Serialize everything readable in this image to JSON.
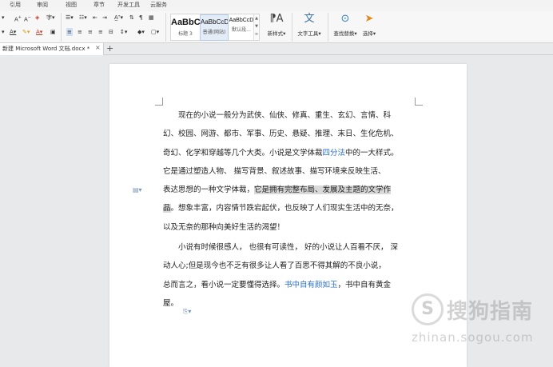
{
  "menubar": {
    "items": [
      "引用",
      "审阅",
      "视图",
      "章节",
      "开发工具",
      "云服务"
    ]
  },
  "ribbon": {
    "styles": [
      {
        "preview": "AaBbC",
        "name": "标题 3"
      },
      {
        "preview": "AaBbCcD",
        "name": "普通(网站)"
      },
      {
        "preview": "AaBbCcD",
        "name": "默认段..."
      }
    ],
    "new_style": "新样式",
    "text_tools": "文字工具",
    "find_replace": "查找替换",
    "select": "选择"
  },
  "tabbar": {
    "doc_tab": "新建 Microsoft Word 文档.docx *",
    "close": "×",
    "new_tab": "+"
  },
  "document": {
    "p1": {
      "l1": "现在的小说一般分为武侠、仙侠、修真、重生、玄幻、言情、科",
      "l2": "幻、校园、网游、都市、军事、历史、悬疑、推理、末日、生化危机、",
      "l3_a": "奇幻、化学和穿越等几个大类。小说是文学体裁",
      "l3_link": "四分法",
      "l3_b": "中的一大样式。",
      "l4": "它是通过塑造人物、 描写背景、叙述故事、描写环境来反映生活、",
      "l5_a": "表达思想的一种文学体裁，",
      "l5_hl": "它是拥有完整布局、发展及主题的文学作",
      "l6_hl": "品",
      "l6_b": "。想象丰富，内容情节跌宕起伏，也反映了人们现实生活中的无奈，",
      "l7": "以及无奈的那种向美好生活的渴望！"
    },
    "p2": {
      "l1": "小说有时候很感人， 也很有可读性， 好的小说让人百看不厌， 深",
      "l2": "动人心;但是现今也不乏有很多让人看了百思不得其解的不良小说，",
      "l3_a": "总而言之，看小说一定要懂得选择。",
      "l3_link": "书中自有颜如玉",
      "l3_b": "，书中自有黄金",
      "l4": "屋。"
    }
  },
  "watermark": {
    "logo": "S",
    "title": "搜狗指南",
    "url": "zhinan.sogou.com"
  }
}
